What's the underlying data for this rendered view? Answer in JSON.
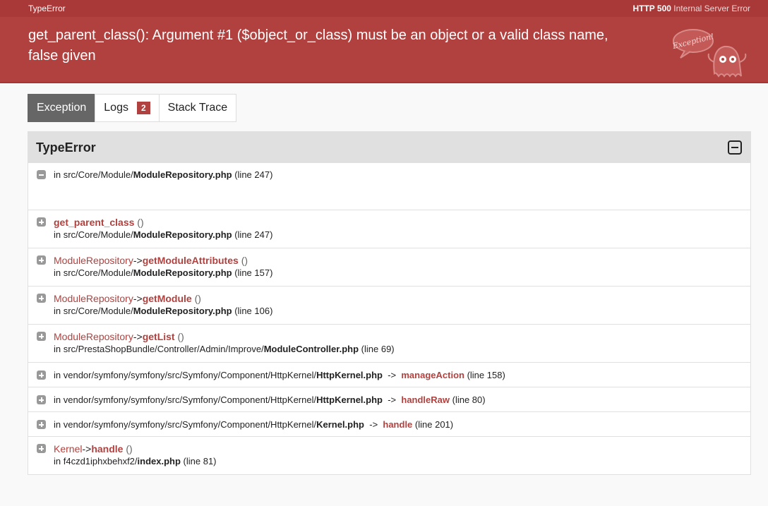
{
  "topbar": {
    "title": "TypeError",
    "status_code": "HTTP 500",
    "status_text": "Internal Server Error"
  },
  "header": {
    "message": "get_parent_class(): Argument #1 ($object_or_class) must be an object or a valid class name, false given",
    "ghost_text": "Exception!"
  },
  "tabs": [
    {
      "label": "Exception"
    },
    {
      "label": "Logs",
      "badge": "2"
    },
    {
      "label": "Stack Trace"
    }
  ],
  "trace": {
    "title": "TypeError",
    "first": {
      "prefix": "in src/Core/Module/",
      "file": "ModuleRepository.php",
      "line": "(line 247)"
    },
    "frames": [
      {
        "cls": "",
        "arrow": "",
        "fn": "get_parent_class",
        "args": "()",
        "prefix": "in src/Core/Module/",
        "file": "ModuleRepository.php",
        "line": "(line 247)"
      },
      {
        "cls": "ModuleRepository",
        "arrow": "->",
        "fn": "getModuleAttributes",
        "args": "()",
        "prefix": "in src/Core/Module/",
        "file": "ModuleRepository.php",
        "line": "(line 157)"
      },
      {
        "cls": "ModuleRepository",
        "arrow": "->",
        "fn": "getModule",
        "args": "()",
        "prefix": "in src/Core/Module/",
        "file": "ModuleRepository.php",
        "line": "(line 106)"
      },
      {
        "cls": "ModuleRepository",
        "arrow": "->",
        "fn": "getList",
        "args": "()",
        "prefix": "in src/PrestaShopBundle/Controller/Admin/Improve/",
        "file": "ModuleController.php",
        "line": "(line 69)"
      }
    ],
    "vendor_frames": [
      {
        "prefix": "in vendor/symfony/symfony/src/Symfony/Component/HttpKernel/",
        "file": "HttpKernel.php",
        "arrow": "->",
        "method": "manageAction",
        "line": "(line 158)"
      },
      {
        "prefix": "in vendor/symfony/symfony/src/Symfony/Component/HttpKernel/",
        "file": "HttpKernel.php",
        "arrow": "->",
        "method": "handleRaw",
        "line": "(line 80)"
      },
      {
        "prefix": "in vendor/symfony/symfony/src/Symfony/Component/HttpKernel/",
        "file": "Kernel.php",
        "arrow": "->",
        "method": "handle",
        "line": "(line 201)"
      }
    ],
    "last": {
      "cls": "Kernel",
      "arrow": "->",
      "fn": "handle",
      "args": "()",
      "prefix": "in f4czd1iphxbehxf2/",
      "file": "index.php",
      "line": "(line 81)"
    }
  },
  "colors": {
    "header_bg": "#b0413e",
    "topbar_bg": "#a93838",
    "accent": "#b0413e",
    "tab_active_bg": "#666666"
  }
}
